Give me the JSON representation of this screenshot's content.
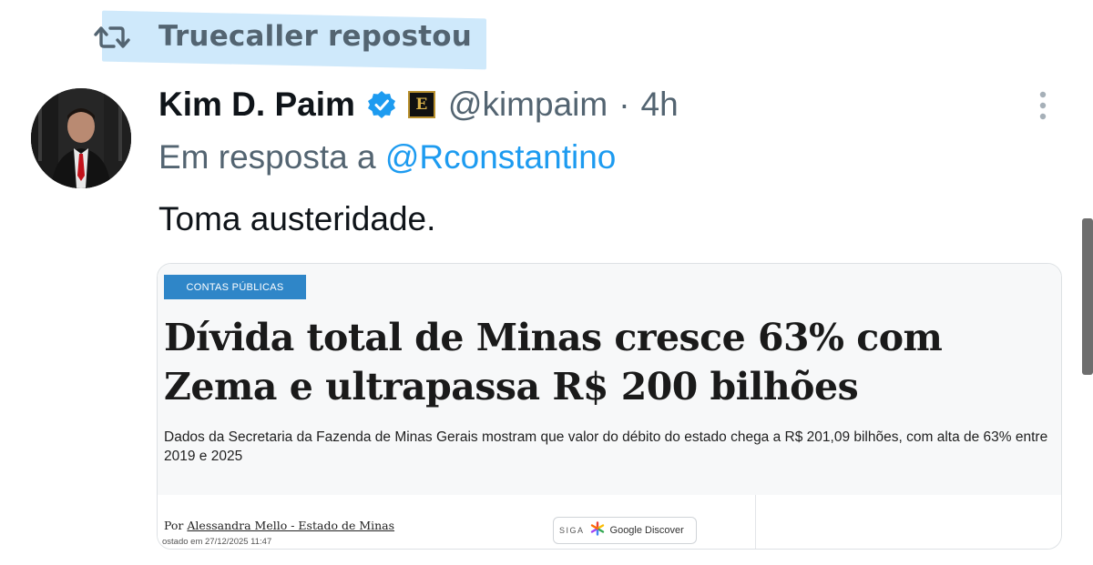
{
  "repost": {
    "label": "Truecaller repostou",
    "icon": "repost-icon"
  },
  "tweet": {
    "author_name": "Kim D. Paim",
    "author_handle": "@kimpaim",
    "separator": "·",
    "time": "4h",
    "badge_label": "E",
    "reply_prefix": "Em resposta a",
    "reply_mention": "@Rconstantino",
    "text": "Toma austeridade.",
    "icons": [
      "verified-icon",
      "more-icon"
    ],
    "colors": {
      "handle": "#536471",
      "mention": "#1d9bf0",
      "verified": "#1d9bf0"
    }
  },
  "card": {
    "tag": "CONTAS PÚBLICAS",
    "headline": "Dívida total de Minas cresce 63% com Zema e ultrapassa R$ 200 bilhões",
    "subhead": "Dados da Secretaria da Fazenda de Minas Gerais mostram que valor do débito do estado chega a R$ 201,09 bilhões, com alta de 63% entre 2019 e 2025",
    "byline_prefix": "Por",
    "byline_author": "Alessandra Mello - Estado de Minas",
    "posted": "ostado em 27/12/2025 11:47",
    "discover_follow": "SIGA",
    "discover_label": "Google Discover",
    "colors": {
      "tag_bg": "#2f86c8"
    }
  }
}
